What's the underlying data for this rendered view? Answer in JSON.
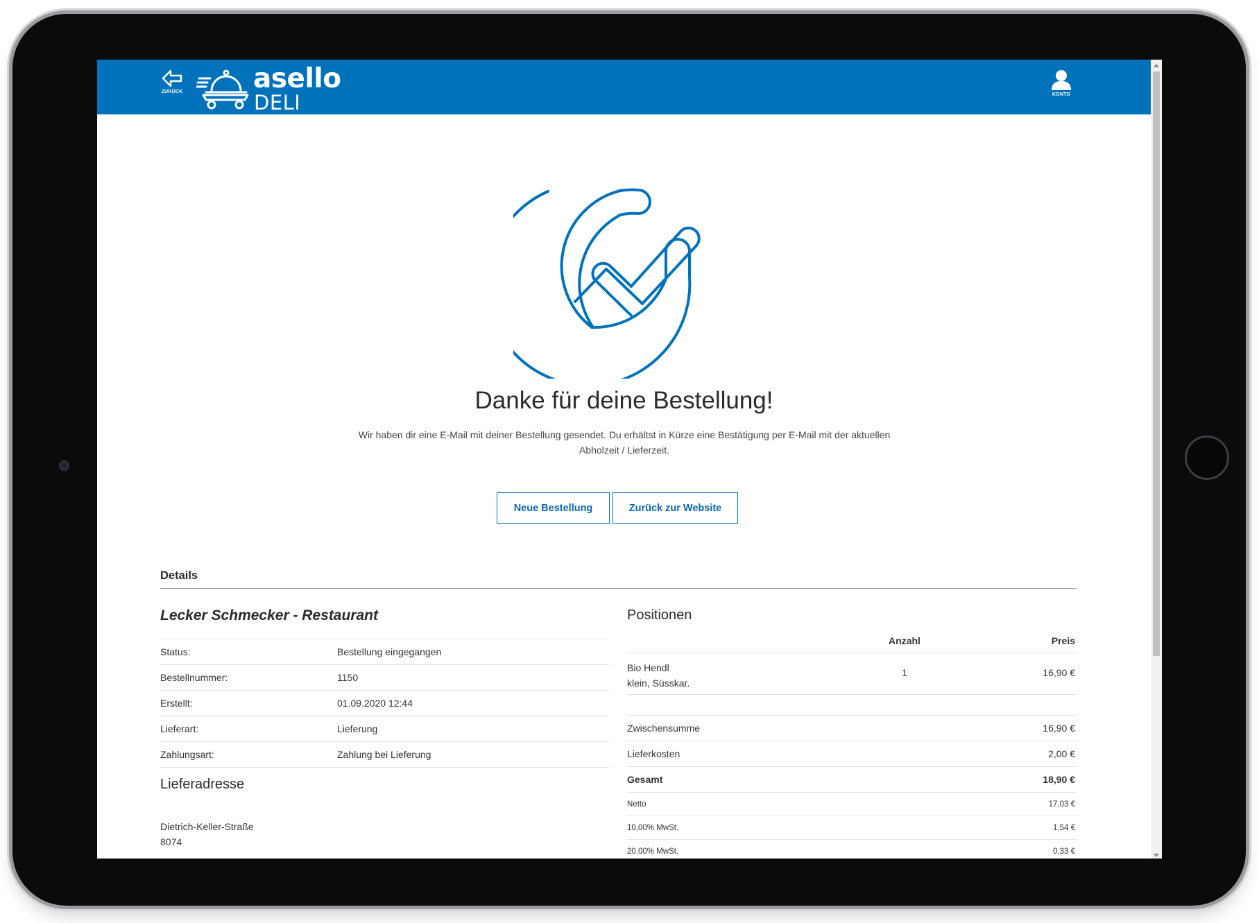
{
  "header": {
    "back_label": "ZURÜCK",
    "logo_top": "asello",
    "logo_bottom": "DELI",
    "account_label": "KONTO",
    "brand_color": "#0072bc"
  },
  "hero": {
    "icon": "checkmark-circle-icon",
    "title": "Danke für deine Bestellung!",
    "text": "Wir haben dir eine E-Mail mit deiner Bestellung gesendet. Du erhältst in Kürze eine Bestätigung per E-Mail mit der aktuellen Abholzeit / Lieferzeit."
  },
  "actions": {
    "new_order": "Neue Bestellung",
    "back_to_website": "Zurück zur Website"
  },
  "details": {
    "heading": "Details",
    "restaurant": "Lecker Schmecker - Restaurant",
    "rows": [
      {
        "label": "Status:",
        "value": "Bestellung eingegangen"
      },
      {
        "label": "Bestellnummer:",
        "value": "1150"
      },
      {
        "label": "Erstellt:",
        "value": "01.09.2020 12:44"
      },
      {
        "label": "Lieferart:",
        "value": "Lieferung"
      },
      {
        "label": "Zahlungsart:",
        "value": "Zahlung bei Lieferung"
      }
    ],
    "address_heading": "Lieferadresse",
    "address_lines": [
      "Dietrich-Keller-Straße",
      "8074"
    ]
  },
  "positions": {
    "heading": "Positionen",
    "col_qty": "Anzahl",
    "col_price": "Preis",
    "items": [
      {
        "name": "Bio Hendl",
        "detail": "klein, Süsskar.",
        "qty": "1",
        "price": "16,90 €"
      }
    ],
    "totals": [
      {
        "label": "Zwischensumme",
        "value": "16,90 €"
      },
      {
        "label": "Lieferkosten",
        "value": "2,00 €"
      },
      {
        "label": "Gesamt",
        "value": "18,90 €"
      },
      {
        "label": "Netto",
        "value": "17,03 €"
      },
      {
        "label": "10,00% MwSt.",
        "value": "1,54 €"
      },
      {
        "label": "20,00% MwSt.",
        "value": "0,33 €"
      }
    ]
  }
}
